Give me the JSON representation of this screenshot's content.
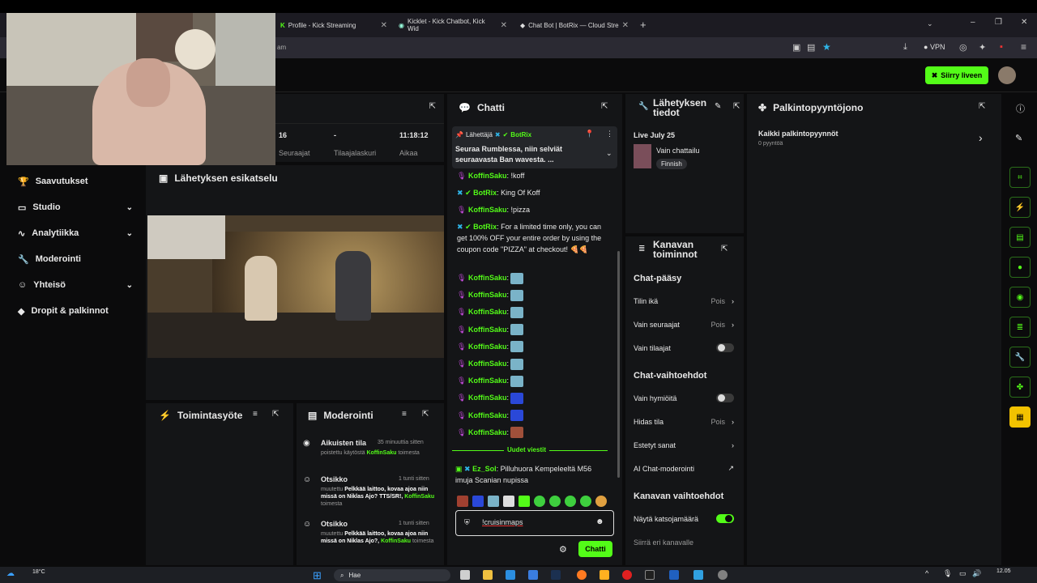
{
  "browser": {
    "tabs": [
      {
        "label": "Profile - Kick Streaming"
      },
      {
        "label": "Kicklet - Kick Chatbot, Kick Wid"
      },
      {
        "label": "Chat Bot | BotRix — Cloud Stre"
      }
    ],
    "address_fragment": "am",
    "vpn_label": "VPN"
  },
  "header": {
    "go_live_label": "Siirry liveen"
  },
  "sidebar": {
    "items": [
      {
        "label": "Saavutukset"
      },
      {
        "label": "Studio"
      },
      {
        "label": "Analytiikka"
      },
      {
        "label": "Moderointi"
      },
      {
        "label": "Yhteisö"
      },
      {
        "label": "Dropit & palkinnot"
      }
    ]
  },
  "stats": {
    "followers_value": "16",
    "followers_label": "Seuraajat",
    "subs_value": "-",
    "subs_label": "Tilaajalaskuri",
    "time_value": "11:18:12",
    "time_label": "Aikaa"
  },
  "preview": {
    "title": "Lähetyksen esikatselu"
  },
  "activity": {
    "title": "Toimintasyöte"
  },
  "moderation": {
    "title": "Moderointi",
    "entries": [
      {
        "title": "Aikuisten tila",
        "time": "35 minuuttia sitten",
        "line1": "poistettu käytöstä",
        "user": "KoffinSaku",
        "line2": "toimesta"
      },
      {
        "title": "Otsikko",
        "time": "1 tunti sitten",
        "line1": "muutettu",
        "text": "Pelkkää laittoo, kovaa ajoa niin missä on Niklas Ajo? TTS/SR!,",
        "user": "KoffinSaku",
        "line2": "toimesta"
      },
      {
        "title": "Otsikko",
        "time": "1 tunti sitten",
        "line1": "muutettu",
        "text": "Pelkkää laittoo, kovaa ajoa niin missä on Niklas Ajo?,",
        "user": "KoffinSaku",
        "line2": "toimesta"
      }
    ]
  },
  "chat": {
    "title": "Chatti",
    "pinned_label": "Lähettäjä",
    "pinned_user": "BotRix",
    "pinned_text": "Seuraa Rumblessa, niin selviät seuraavasta Ban wavesta.",
    "pinned_ellipsis": "...",
    "messages": [
      {
        "user": "KoffinSaku",
        "text": "!koff"
      },
      {
        "user": "BotRix",
        "text": "King Of Koff"
      },
      {
        "user": "KoffinSaku",
        "text": "!pizza"
      },
      {
        "user": "BotRix",
        "text": "For a limited time only, you can get 100% OFF your entire order by using the coupon code \"PIZZA\" at checkout! 🍕🍕"
      }
    ],
    "emote_user": "KoffinSaku",
    "new_messages_label": "Uudet viestit",
    "last_user": "Ez_Sol",
    "last_text": "Pilluhuora Kempeleeltä M56 imuja Scanian nupissa",
    "input_value": "!cruisinmaps",
    "send_label": "Chatti"
  },
  "stream_info": {
    "title": "Lähetyksen tiedot",
    "live_date": "Live July 25",
    "category": "Vain chattailu",
    "tag": "Finnish"
  },
  "channel_actions": {
    "title": "Kanavan toiminnot",
    "chat_access": "Chat-pääsy",
    "account_age": "Tilin ikä",
    "account_age_val": "Pois",
    "followers_only": "Vain seuraajat",
    "followers_only_val": "Pois",
    "subs_only": "Vain tilaajat",
    "chat_options": "Chat-vaihtoehdot",
    "emote_only": "Vain hymiöitä",
    "slow_mode": "Hidas tila",
    "slow_mode_val": "Pois",
    "banned_words": "Estetyt sanat",
    "ai_mod": "AI Chat-moderointi",
    "channel_options": "Kanavan vaihtoehdot",
    "show_viewers": "Näytä katsojamäärä",
    "move_channels": "Siirrä eri kanavalle"
  },
  "rewards": {
    "title": "Palkintopyyntöjono",
    "all_label": "Kaikki palkintopyynnöt",
    "count_label": "0 pyyntöä"
  },
  "taskbar": {
    "temp": "18°C",
    "search_label": "Hae",
    "clock": "12.05"
  }
}
